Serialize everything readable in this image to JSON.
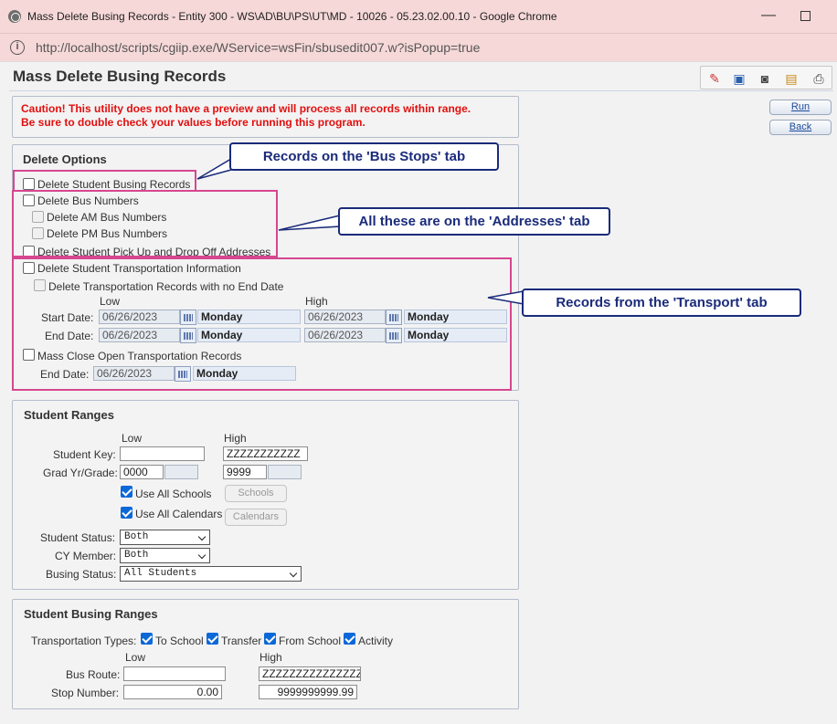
{
  "window": {
    "title": "Mass Delete Busing Records - Entity 300 - WS\\AD\\BU\\PS\\UT\\MD - 10026 - 05.23.02.00.10 - Google Chrome",
    "url": "http://localhost/scripts/cgiip.exe/WService=wsFin/sbusedit007.w?isPopup=true"
  },
  "page": {
    "title": "Mass Delete Busing Records",
    "toolbar_icons": [
      "run-report-icon",
      "monitor-icon",
      "camera-icon",
      "clipboard-icon",
      "printer-icon"
    ]
  },
  "buttons": {
    "run": "Run",
    "back": "Back"
  },
  "caution": {
    "line1": "Caution! This utility does not have a preview and will process all records within range.",
    "line2": "Be sure to double check your values before running this program."
  },
  "delete_options": {
    "heading": "Delete Options",
    "student_busing": "Delete Student Busing Records",
    "bus_numbers": "Delete Bus Numbers",
    "am_bus": "Delete AM Bus Numbers",
    "pm_bus": "Delete PM Bus Numbers",
    "pickup_dropoff": "Delete Student Pick Up and Drop Off Addresses",
    "transport_info": "Delete Student Transportation Information",
    "no_end_date": "Delete Transportation Records with no End Date",
    "low": "Low",
    "high": "High",
    "start_date_label": "Start Date:",
    "end_date_label": "End Date:",
    "start_low": "06/26/2023",
    "start_low_day": "Monday",
    "start_high": "06/26/2023",
    "start_high_day": "Monday",
    "end_low": "06/26/2023",
    "end_low_day": "Monday",
    "end_high": "06/26/2023",
    "end_high_day": "Monday",
    "mass_close": "Mass Close Open Transportation Records",
    "close_end_label": "End Date:",
    "close_end": "06/26/2023",
    "close_end_day": "Monday"
  },
  "callouts": {
    "bus_stops": "Records on the 'Bus Stops' tab",
    "addresses": "All these are on the 'Addresses' tab",
    "transport": "Records from the 'Transport' tab"
  },
  "student_ranges": {
    "heading": "Student Ranges",
    "low": "Low",
    "high": "High",
    "student_key_label": "Student Key:",
    "student_key_low": "",
    "student_key_high": "ZZZZZZZZZZZ",
    "grad_label": "Grad Yr/Grade:",
    "grad_low": "0000",
    "grad_high": "9999",
    "use_all_schools": "Use All Schools",
    "schools_btn": "Schools",
    "use_all_calendars": "Use All Calendars",
    "calendars_btn": "Calendars",
    "status_label": "Student Status:",
    "status_value": "Both",
    "cy_label": "CY Member:",
    "cy_value": "Both",
    "busing_label": "Busing Status:",
    "busing_value": "All Students"
  },
  "busing_ranges": {
    "heading": "Student Busing Ranges",
    "types_label": "Transportation Types:",
    "to_school": "To School",
    "transfer": "Transfer",
    "from_school": "From School",
    "activity": "Activity",
    "low": "Low",
    "high": "High",
    "route_label": "Bus Route:",
    "route_low": "",
    "route_high": "ZZZZZZZZZZZZZZZ",
    "stop_label": "Stop Number:",
    "stop_low": "0.00",
    "stop_high": "9999999999.99"
  }
}
